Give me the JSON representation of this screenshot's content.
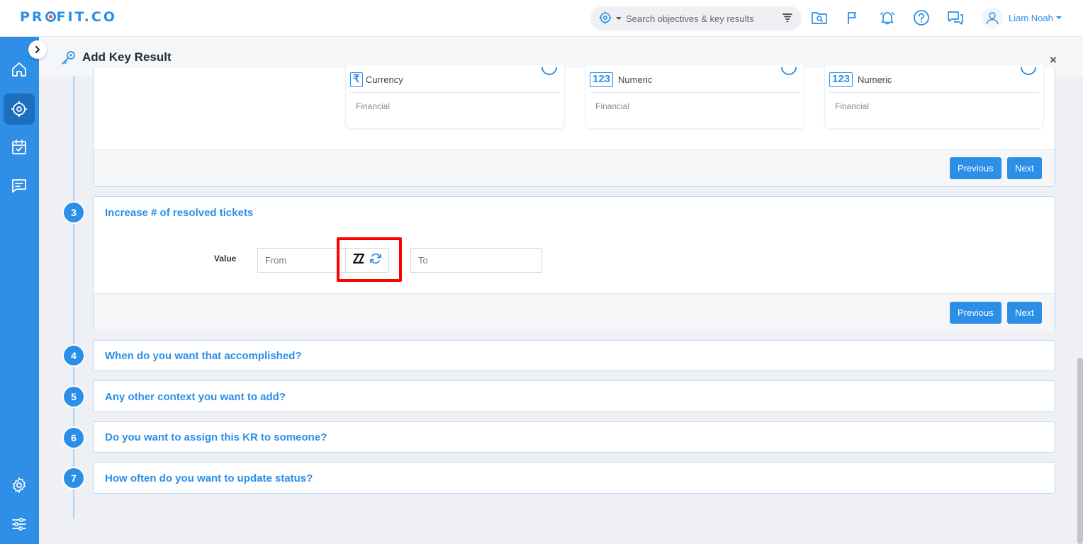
{
  "app": {
    "logo": "PROFIT.CO"
  },
  "header": {
    "search_placeholder": "Search objectives & key results",
    "user_name": "Liam Noah"
  },
  "drawer": {
    "title": "Add Key Result",
    "close": "×"
  },
  "types": [
    {
      "badge": "₹",
      "label": "Currency",
      "category": "Financial"
    },
    {
      "badge": "123",
      "label": "Numeric",
      "category": "Financial"
    },
    {
      "badge": "123",
      "label": "Numeric",
      "category": "Financial"
    }
  ],
  "buttons": {
    "previous": "Previous",
    "next": "Next"
  },
  "steps": [
    {
      "num": "3",
      "title": "Increase # of resolved tickets"
    },
    {
      "num": "4",
      "title": "When do you want that accomplished?"
    },
    {
      "num": "5",
      "title": "Any other context you want to add?"
    },
    {
      "num": "6",
      "title": "Do you want to assign this KR to someone?"
    },
    {
      "num": "7",
      "title": "How often do you want to update status?"
    }
  ],
  "value_form": {
    "label": "Value",
    "from_placeholder": "From",
    "to_placeholder": "To"
  },
  "colors": {
    "primary": "#2b8fe8",
    "sidebar": "#2f8ee6",
    "highlight": "#ff0000"
  }
}
